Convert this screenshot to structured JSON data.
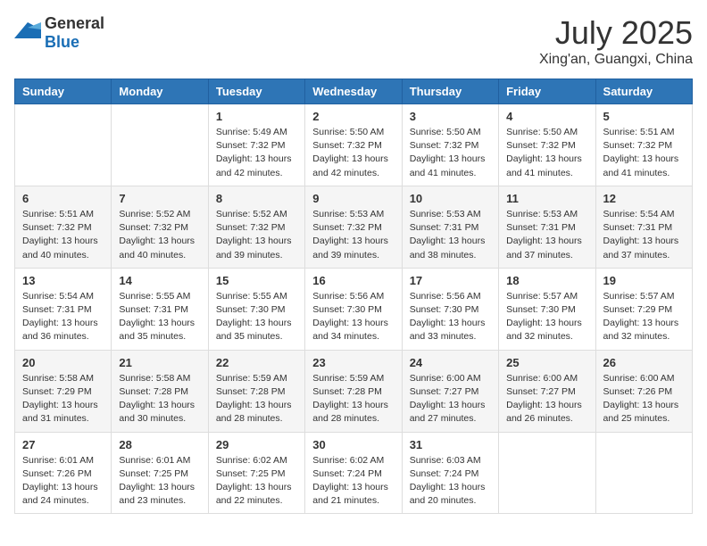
{
  "logo": {
    "general": "General",
    "blue": "Blue"
  },
  "header": {
    "month": "July 2025",
    "location": "Xing'an, Guangxi, China"
  },
  "weekdays": [
    "Sunday",
    "Monday",
    "Tuesday",
    "Wednesday",
    "Thursday",
    "Friday",
    "Saturday"
  ],
  "weeks": [
    [
      {
        "day": "",
        "sunrise": "",
        "sunset": "",
        "daylight": ""
      },
      {
        "day": "",
        "sunrise": "",
        "sunset": "",
        "daylight": ""
      },
      {
        "day": "1",
        "sunrise": "Sunrise: 5:49 AM",
        "sunset": "Sunset: 7:32 PM",
        "daylight": "Daylight: 13 hours and 42 minutes."
      },
      {
        "day": "2",
        "sunrise": "Sunrise: 5:50 AM",
        "sunset": "Sunset: 7:32 PM",
        "daylight": "Daylight: 13 hours and 42 minutes."
      },
      {
        "day": "3",
        "sunrise": "Sunrise: 5:50 AM",
        "sunset": "Sunset: 7:32 PM",
        "daylight": "Daylight: 13 hours and 41 minutes."
      },
      {
        "day": "4",
        "sunrise": "Sunrise: 5:50 AM",
        "sunset": "Sunset: 7:32 PM",
        "daylight": "Daylight: 13 hours and 41 minutes."
      },
      {
        "day": "5",
        "sunrise": "Sunrise: 5:51 AM",
        "sunset": "Sunset: 7:32 PM",
        "daylight": "Daylight: 13 hours and 41 minutes."
      }
    ],
    [
      {
        "day": "6",
        "sunrise": "Sunrise: 5:51 AM",
        "sunset": "Sunset: 7:32 PM",
        "daylight": "Daylight: 13 hours and 40 minutes."
      },
      {
        "day": "7",
        "sunrise": "Sunrise: 5:52 AM",
        "sunset": "Sunset: 7:32 PM",
        "daylight": "Daylight: 13 hours and 40 minutes."
      },
      {
        "day": "8",
        "sunrise": "Sunrise: 5:52 AM",
        "sunset": "Sunset: 7:32 PM",
        "daylight": "Daylight: 13 hours and 39 minutes."
      },
      {
        "day": "9",
        "sunrise": "Sunrise: 5:53 AM",
        "sunset": "Sunset: 7:32 PM",
        "daylight": "Daylight: 13 hours and 39 minutes."
      },
      {
        "day": "10",
        "sunrise": "Sunrise: 5:53 AM",
        "sunset": "Sunset: 7:31 PM",
        "daylight": "Daylight: 13 hours and 38 minutes."
      },
      {
        "day": "11",
        "sunrise": "Sunrise: 5:53 AM",
        "sunset": "Sunset: 7:31 PM",
        "daylight": "Daylight: 13 hours and 37 minutes."
      },
      {
        "day": "12",
        "sunrise": "Sunrise: 5:54 AM",
        "sunset": "Sunset: 7:31 PM",
        "daylight": "Daylight: 13 hours and 37 minutes."
      }
    ],
    [
      {
        "day": "13",
        "sunrise": "Sunrise: 5:54 AM",
        "sunset": "Sunset: 7:31 PM",
        "daylight": "Daylight: 13 hours and 36 minutes."
      },
      {
        "day": "14",
        "sunrise": "Sunrise: 5:55 AM",
        "sunset": "Sunset: 7:31 PM",
        "daylight": "Daylight: 13 hours and 35 minutes."
      },
      {
        "day": "15",
        "sunrise": "Sunrise: 5:55 AM",
        "sunset": "Sunset: 7:30 PM",
        "daylight": "Daylight: 13 hours and 35 minutes."
      },
      {
        "day": "16",
        "sunrise": "Sunrise: 5:56 AM",
        "sunset": "Sunset: 7:30 PM",
        "daylight": "Daylight: 13 hours and 34 minutes."
      },
      {
        "day": "17",
        "sunrise": "Sunrise: 5:56 AM",
        "sunset": "Sunset: 7:30 PM",
        "daylight": "Daylight: 13 hours and 33 minutes."
      },
      {
        "day": "18",
        "sunrise": "Sunrise: 5:57 AM",
        "sunset": "Sunset: 7:30 PM",
        "daylight": "Daylight: 13 hours and 32 minutes."
      },
      {
        "day": "19",
        "sunrise": "Sunrise: 5:57 AM",
        "sunset": "Sunset: 7:29 PM",
        "daylight": "Daylight: 13 hours and 32 minutes."
      }
    ],
    [
      {
        "day": "20",
        "sunrise": "Sunrise: 5:58 AM",
        "sunset": "Sunset: 7:29 PM",
        "daylight": "Daylight: 13 hours and 31 minutes."
      },
      {
        "day": "21",
        "sunrise": "Sunrise: 5:58 AM",
        "sunset": "Sunset: 7:28 PM",
        "daylight": "Daylight: 13 hours and 30 minutes."
      },
      {
        "day": "22",
        "sunrise": "Sunrise: 5:59 AM",
        "sunset": "Sunset: 7:28 PM",
        "daylight": "Daylight: 13 hours and 28 minutes."
      },
      {
        "day": "23",
        "sunrise": "Sunrise: 5:59 AM",
        "sunset": "Sunset: 7:28 PM",
        "daylight": "Daylight: 13 hours and 28 minutes."
      },
      {
        "day": "24",
        "sunrise": "Sunrise: 6:00 AM",
        "sunset": "Sunset: 7:27 PM",
        "daylight": "Daylight: 13 hours and 27 minutes."
      },
      {
        "day": "25",
        "sunrise": "Sunrise: 6:00 AM",
        "sunset": "Sunset: 7:27 PM",
        "daylight": "Daylight: 13 hours and 26 minutes."
      },
      {
        "day": "26",
        "sunrise": "Sunrise: 6:00 AM",
        "sunset": "Sunset: 7:26 PM",
        "daylight": "Daylight: 13 hours and 25 minutes."
      }
    ],
    [
      {
        "day": "27",
        "sunrise": "Sunrise: 6:01 AM",
        "sunset": "Sunset: 7:26 PM",
        "daylight": "Daylight: 13 hours and 24 minutes."
      },
      {
        "day": "28",
        "sunrise": "Sunrise: 6:01 AM",
        "sunset": "Sunset: 7:25 PM",
        "daylight": "Daylight: 13 hours and 23 minutes."
      },
      {
        "day": "29",
        "sunrise": "Sunrise: 6:02 AM",
        "sunset": "Sunset: 7:25 PM",
        "daylight": "Daylight: 13 hours and 22 minutes."
      },
      {
        "day": "30",
        "sunrise": "Sunrise: 6:02 AM",
        "sunset": "Sunset: 7:24 PM",
        "daylight": "Daylight: 13 hours and 21 minutes."
      },
      {
        "day": "31",
        "sunrise": "Sunrise: 6:03 AM",
        "sunset": "Sunset: 7:24 PM",
        "daylight": "Daylight: 13 hours and 20 minutes."
      },
      {
        "day": "",
        "sunrise": "",
        "sunset": "",
        "daylight": ""
      },
      {
        "day": "",
        "sunrise": "",
        "sunset": "",
        "daylight": ""
      }
    ]
  ]
}
